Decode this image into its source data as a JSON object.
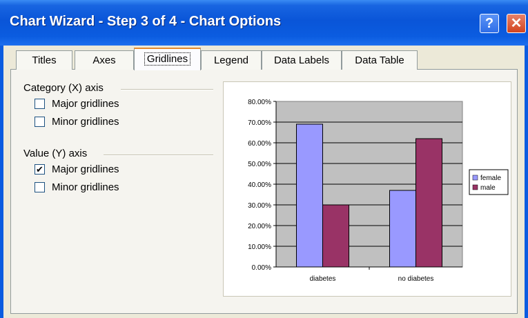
{
  "window": {
    "title": "Chart Wizard - Step 3 of 4 - Chart Options"
  },
  "titlebar": {
    "help_glyph": "?",
    "close_glyph": "✕"
  },
  "tabs": [
    {
      "label": "Titles"
    },
    {
      "label": "Axes"
    },
    {
      "label": "Gridlines",
      "selected": true
    },
    {
      "label": "Legend"
    },
    {
      "label": "Data Labels"
    },
    {
      "label": "Data Table"
    }
  ],
  "category_axis": {
    "label": "Category (X) axis",
    "major_label": "Major gridlines",
    "major_checked": false,
    "minor_label": "Minor gridlines",
    "minor_checked": false
  },
  "value_axis": {
    "label": "Value (Y) axis",
    "major_label": "Major gridlines",
    "major_checked": true,
    "minor_label": "Minor gridlines",
    "minor_checked": false
  },
  "colors": {
    "female": "#9999ff",
    "male": "#993366",
    "plot_bg": "#c0c0c0"
  },
  "chart_data": {
    "type": "bar",
    "categories": [
      "diabetes",
      "no diabetes"
    ],
    "series": [
      {
        "name": "female",
        "values": [
          0.69,
          0.37
        ]
      },
      {
        "name": "male",
        "values": [
          0.3,
          0.62
        ]
      }
    ],
    "yticks": [
      "0.00%",
      "10.00%",
      "20.00%",
      "30.00%",
      "40.00%",
      "50.00%",
      "60.00%",
      "70.00%",
      "80.00%"
    ],
    "ylim": [
      0,
      0.8
    ],
    "grid": "y-major",
    "legend": "right"
  }
}
